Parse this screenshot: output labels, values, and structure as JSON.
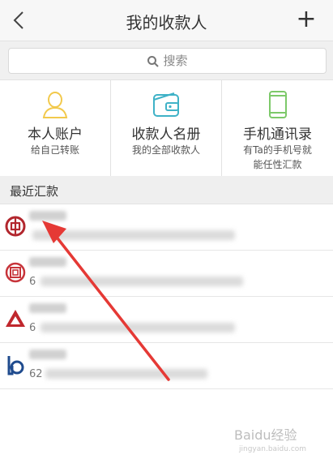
{
  "header": {
    "title": "我的收款人",
    "back_icon": "back-chevron-icon",
    "add_icon": "plus-icon",
    "add_label": "+"
  },
  "search": {
    "placeholder": "搜索",
    "icon": "search-icon"
  },
  "quick_actions": [
    {
      "title": "本人账户",
      "subtitle": "给自己转账",
      "icon": "person-icon",
      "color": "#f2c94c"
    },
    {
      "title": "收款人名册",
      "subtitle": "我的全部收款人",
      "icon": "wallet-icon",
      "color": "#3fb2c7"
    },
    {
      "title": "手机通讯录",
      "subtitle": "有Ta的手机号就\n能任性汇款",
      "icon": "phone-icon",
      "color": "#7dc96a"
    }
  ],
  "recent": {
    "header": "最近汇款",
    "items": [
      {
        "bank_icon": "boc-logo-icon",
        "account_prefix": "",
        "color": "#b2272e"
      },
      {
        "bank_icon": "icbc-logo-icon",
        "account_prefix": "6",
        "color": "#c7343a"
      },
      {
        "bank_icon": "ccb-like-logo-icon",
        "account_prefix": "6",
        "color": "#c0272d"
      },
      {
        "bank_icon": "boc-comm-logo-icon",
        "account_prefix": "62",
        "color": "#1f4b8e"
      }
    ]
  },
  "watermark": {
    "text": "Baidu经验",
    "subtext": "jingyan.baidu.com"
  },
  "colors": {
    "arrow": "#e53935",
    "background": "#ffffff"
  }
}
